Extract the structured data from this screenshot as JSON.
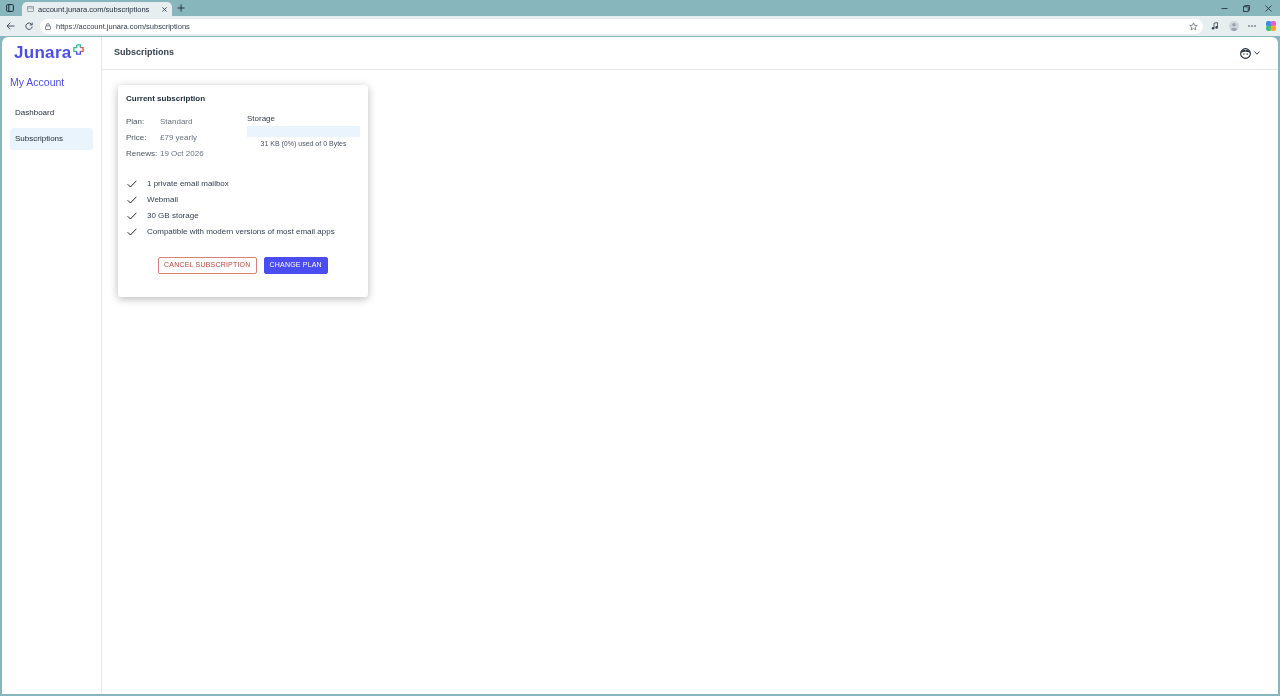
{
  "browser": {
    "tabs": [
      {
        "title": "account.junara.com/subscriptions",
        "selected": true
      }
    ],
    "address": "https://account.junara.com/subscriptions"
  },
  "sidebar": {
    "logo": "Junara",
    "heading": "My Account",
    "items": [
      {
        "label": "Dashboard",
        "selected": false
      },
      {
        "label": "Subscriptions",
        "selected": true
      }
    ]
  },
  "header": {
    "title": "Subscriptions"
  },
  "card": {
    "title": "Current subscription",
    "details": [
      {
        "label": "Plan:",
        "value": "Standard"
      },
      {
        "label": "Price:",
        "value": "£79 yearly"
      },
      {
        "label": "Renews:",
        "value": "19 Oct 2026"
      }
    ],
    "storage": {
      "label": "Storage",
      "level": 0,
      "caption": "31 KB (0%) used of 0 Bytes"
    },
    "features": [
      "1 private email mailbox",
      "Webmail",
      "30 GB storage",
      "Compatible with modern versions of most email apps"
    ],
    "buttons": [
      {
        "label": "CANCEL SUBSCRIPTION",
        "kind": "outline"
      },
      {
        "label": "CHANGE PLAN",
        "kind": "primary"
      }
    ]
  }
}
